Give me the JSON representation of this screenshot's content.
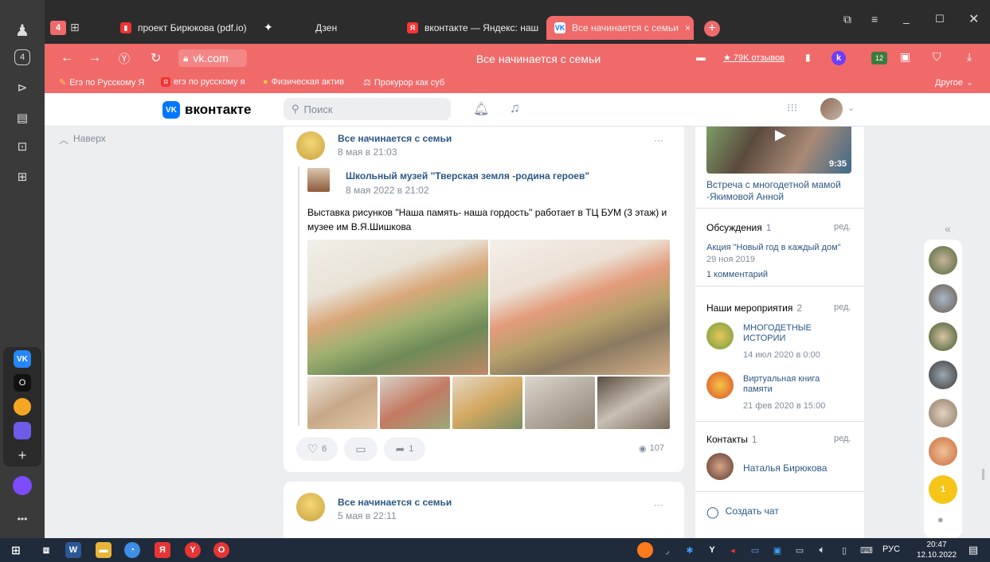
{
  "colors": {
    "accent": "#f06a6a",
    "vk_blue": "#0077ff",
    "link": "#2a5885",
    "meta": "#818c99"
  },
  "browser": {
    "tab_count": "4",
    "tabs": [
      {
        "label": "проект Бирюкова (pdf.io)"
      },
      {
        "label": "Дзен"
      },
      {
        "label": "вконтакте — Яндекс: наш"
      },
      {
        "label": "Все начинается с семьи"
      }
    ],
    "url": "vk.com",
    "page_title": "Все начинается с семьи",
    "reviews": "★ 79K отзывов",
    "badge_count": "12",
    "bookmarks": [
      {
        "label": "Егэ по Русскому Я"
      },
      {
        "label": "егэ по русскому я"
      },
      {
        "label": "Физическая актив"
      },
      {
        "label": "Прокурор как суб"
      }
    ],
    "other_bookmarks": "Другое"
  },
  "vk": {
    "logo": "вконтакте",
    "search_placeholder": "Поиск",
    "back_to_top": "Наверх"
  },
  "post1": {
    "author": "Все начинается с семьи",
    "date": "8 мая в 21:03",
    "repost_author": "Школьный музей \"Тверская земля -родина героев\"",
    "repost_date": "8 мая 2022 в 21:02",
    "text": "Выставка рисунков \"Наша память- наша гордость\" работает в ТЦ БУМ (3 этаж) и музее им В.Я.Шишкова",
    "likes": "6",
    "shares": "1",
    "views": "107"
  },
  "post2": {
    "author": "Все начинается с семьи",
    "date": "5 мая в 22:11"
  },
  "right": {
    "video_duration": "9:35",
    "video_title": "Встреча с многодетной мамой -Якимовой Анной",
    "discussions_label": "Обсуждения",
    "discussions_count": "1",
    "edit": "ред.",
    "topic_title": "Акция \"Новый год в каждый дом\"",
    "topic_date": "29 ноя 2019",
    "topic_comments": "1 комментарий",
    "events_label": "Наши мероприятия",
    "events_count": "2",
    "events": [
      {
        "title": "МНОГОДЕТНЫЕ ИСТОРИИ",
        "date": "14 июл 2020 в 0:00"
      },
      {
        "title": "Виртуальная книга памяти",
        "date": "21 фев 2020 в 15:00"
      }
    ],
    "contacts_label": "Контакты",
    "contacts_count": "1",
    "contact_name": "Наталья Бирюкова",
    "create_chat": "Создать чат"
  },
  "chat_badge": "1",
  "taskbar": {
    "lang": "РУС",
    "time": "20:47",
    "date": "12.10.2022"
  }
}
